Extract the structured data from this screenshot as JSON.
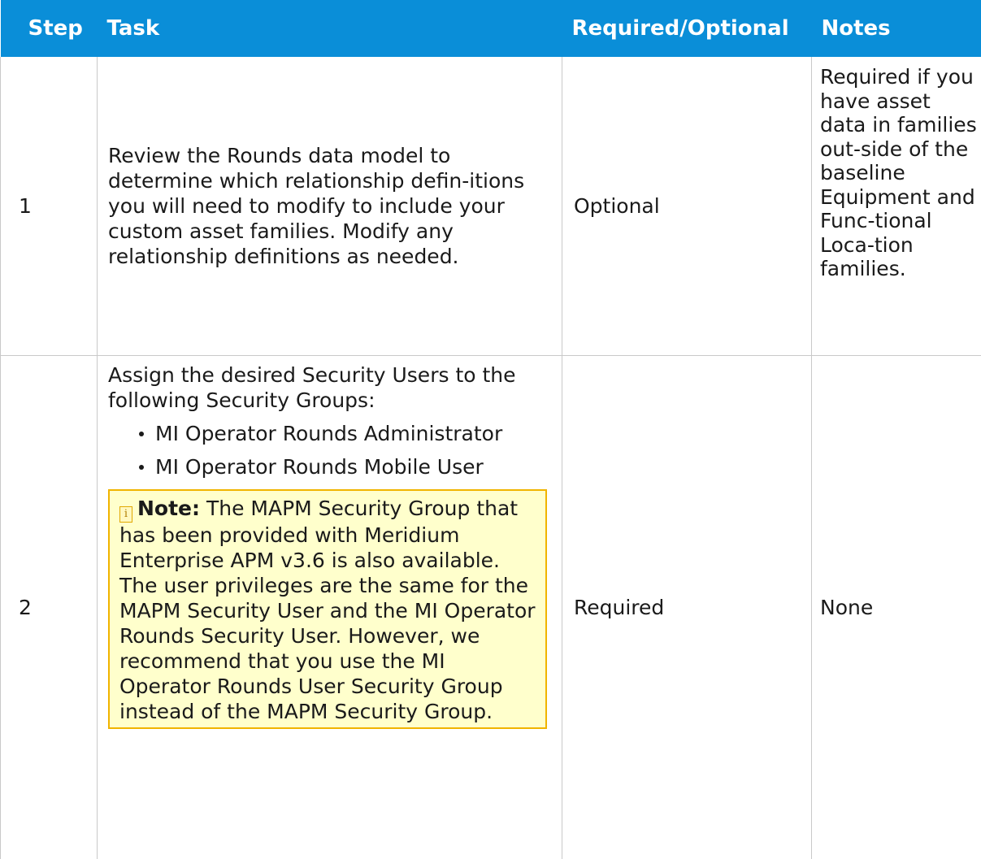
{
  "table": {
    "headers": [
      "Step",
      "Task",
      "Required/Optional",
      "Notes"
    ],
    "rows": [
      {
        "step": "1",
        "task": "Review the Rounds data model to determine which relationship defin-itions you will need to modify to include your custom asset families. Modify any relationship definitions as needed.",
        "required": "Optional",
        "notes": "Required if you have asset data in families out-side of the baseline Equipment and Func-tional Loca-tion families."
      },
      {
        "step": "2",
        "task_intro": "Assign the desired Security Users to the following Security Groups:",
        "task_bullets": [
          "MI Operator Rounds Administrator",
          "MI Operator Rounds Mobile User"
        ],
        "note_label": "Note:",
        "note_text": "The MAPM Security Group that has been provided with Meridium Enterprise APM v3.6 is also available. The user privileges are the same for the MAPM Security User and the MI Operator Rounds Security User. However, we recommend that you use the MI Operator Rounds User Security Group instead of the MAPM Security Group.",
        "required": "Required",
        "notes": "None"
      }
    ]
  },
  "colors": {
    "header_bg": "#0a8ed8",
    "note_bg": "#ffffcc",
    "note_border": "#f0b400"
  },
  "icons": {
    "note": "info-note-icon"
  }
}
